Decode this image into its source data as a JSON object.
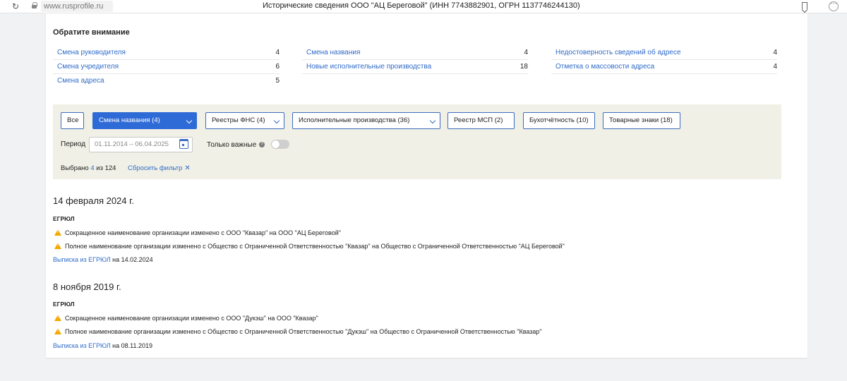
{
  "browser": {
    "url": "www.rusprofile.ru",
    "title": "Исторические сведения ООО \"АЦ Береговой\" (ИНН 7743882901, ОГРН 1137746244130)"
  },
  "notice": {
    "title": "Обратите внимание",
    "col1": [
      {
        "label": "Смена руководителя",
        "count": "4"
      },
      {
        "label": "Смена учредителя",
        "count": "6"
      },
      {
        "label": "Смена адреса",
        "count": "5"
      }
    ],
    "col2": [
      {
        "label": "Смена названия",
        "count": "4"
      },
      {
        "label": "Новые исполнительные производства",
        "count": "18"
      }
    ],
    "col3": [
      {
        "label": "Недостоверность сведений об адресе",
        "count": "4"
      },
      {
        "label": "Отметка о массовости адреса",
        "count": "4"
      }
    ]
  },
  "filters": {
    "chips": [
      "Все",
      "Смена названия (4)",
      "Реестры ФНС (4)",
      "Исполнительные производства (36)",
      "Реестр МСП (2)",
      "Бухотчётность (10)",
      "Товарные знаки (18)"
    ],
    "period_label": "Период",
    "period_value": "01.11.2014 – 06.04.2025",
    "important_label": "Только важные",
    "selected_prefix": "Выбрано",
    "selected_num": "4",
    "selected_suffix": "из 124",
    "reset_label": "Сбросить фильтр"
  },
  "events": [
    {
      "date": "14 февраля 2024 г.",
      "source": "ЕГРЮЛ",
      "lines": [
        "Сокращенное наименование организации изменено с ООО \"Квазар\" на ООО \"АЦ Береговой\"",
        "Полное наименование организации изменено с Общество с Ограниченной Ответственностью \"Квазар\" на Общество с Ограниченной Ответственностью \"АЦ Береговой\""
      ],
      "link_label": "Выписка из ЕГРЮЛ",
      "link_suffix": "на 14.02.2024"
    },
    {
      "date": "8 ноября 2019 г.",
      "source": "ЕГРЮЛ",
      "lines": [
        "Сокращенное наименование организации изменено с ООО \"Дукэш\" на ООО \"Квазар\"",
        "Полное наименование организации изменено с Общество с Ограниченной Ответственностью \"Дукэш\" на Общество с Ограниченной Ответственностью \"Квазар\""
      ],
      "link_label": "Выписка из ЕГРЮЛ",
      "link_suffix": "на 08.11.2019"
    }
  ],
  "colors": {
    "link": "#2f6bc8",
    "accent": "#2f6bd6",
    "warning": "#f2a900",
    "filter_bg": "#f0f0e6"
  }
}
